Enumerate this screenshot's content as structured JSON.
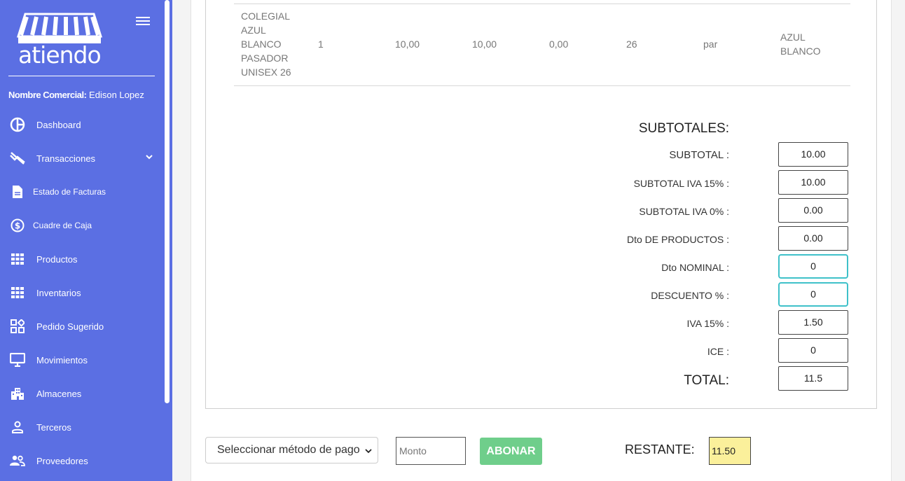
{
  "sidebar": {
    "logo_text": "atiendo",
    "merchant_label": "Nombre Comercial:",
    "merchant_name": "Edison Lopez",
    "items": [
      {
        "label": "Dashboard",
        "icon": "pie-chart-icon"
      },
      {
        "label": "Transacciones",
        "icon": "no-transactions-icon"
      },
      {
        "label": "Estado de Facturas",
        "icon": "document-icon"
      },
      {
        "label": "Cuadre de Caja",
        "icon": "dollar-circle-icon"
      },
      {
        "label": "Productos",
        "icon": "grid-icon"
      },
      {
        "label": "Inventarios",
        "icon": "grid-icon"
      },
      {
        "label": "Pedido Sugerido",
        "icon": "widgets-icon"
      },
      {
        "label": "Movimientos",
        "icon": "monitor-icon"
      },
      {
        "label": "Almacenes",
        "icon": "buildings-icon"
      },
      {
        "label": "Terceros",
        "icon": "person-icon"
      },
      {
        "label": "Proveedores",
        "icon": "people-icon"
      }
    ],
    "accent_color": "#5b6fe3"
  },
  "table": {
    "row": {
      "description": "COLEGIAL AZUL BLANCO PASADOR UNISEX 26",
      "quantity": "1",
      "price": "10,00",
      "subtotal": "10,00",
      "discount": "0,00",
      "size": "26",
      "unit": "par",
      "color": "AZUL BLANCO"
    }
  },
  "totals": {
    "title": "SUBTOTALES:",
    "subtotal_label": "SUBTOTAL :",
    "subtotal_value": "10.00",
    "subtotal_iva15_label": "SUBTOTAL IVA 15% :",
    "subtotal_iva15_value": "10.00",
    "subtotal_iva0_label": "SUBTOTAL IVA 0% :",
    "subtotal_iva0_value": "0.00",
    "dto_productos_label": "Dto DE PRODUCTOS :",
    "dto_productos_value": "0.00",
    "dto_nominal_label": "Dto NOMINAL :",
    "dto_nominal_value": "0",
    "descuento_label": "DESCUENTO % :",
    "descuento_value": "0",
    "iva15_label": "IVA 15% :",
    "iva15_value": "1.50",
    "ice_label": "ICE :",
    "ice_value": "0",
    "total_label": "TOTAL:",
    "total_value": "11.5"
  },
  "payment": {
    "method_selected": "Seleccionar método de pago",
    "monto_placeholder": "Monto",
    "abonar_label": "ABONAR",
    "restante_label": "RESTANTE:",
    "restante_value": "11.50",
    "abonar_color": "#6fce8b",
    "restante_bg": "#fbf09b"
  }
}
